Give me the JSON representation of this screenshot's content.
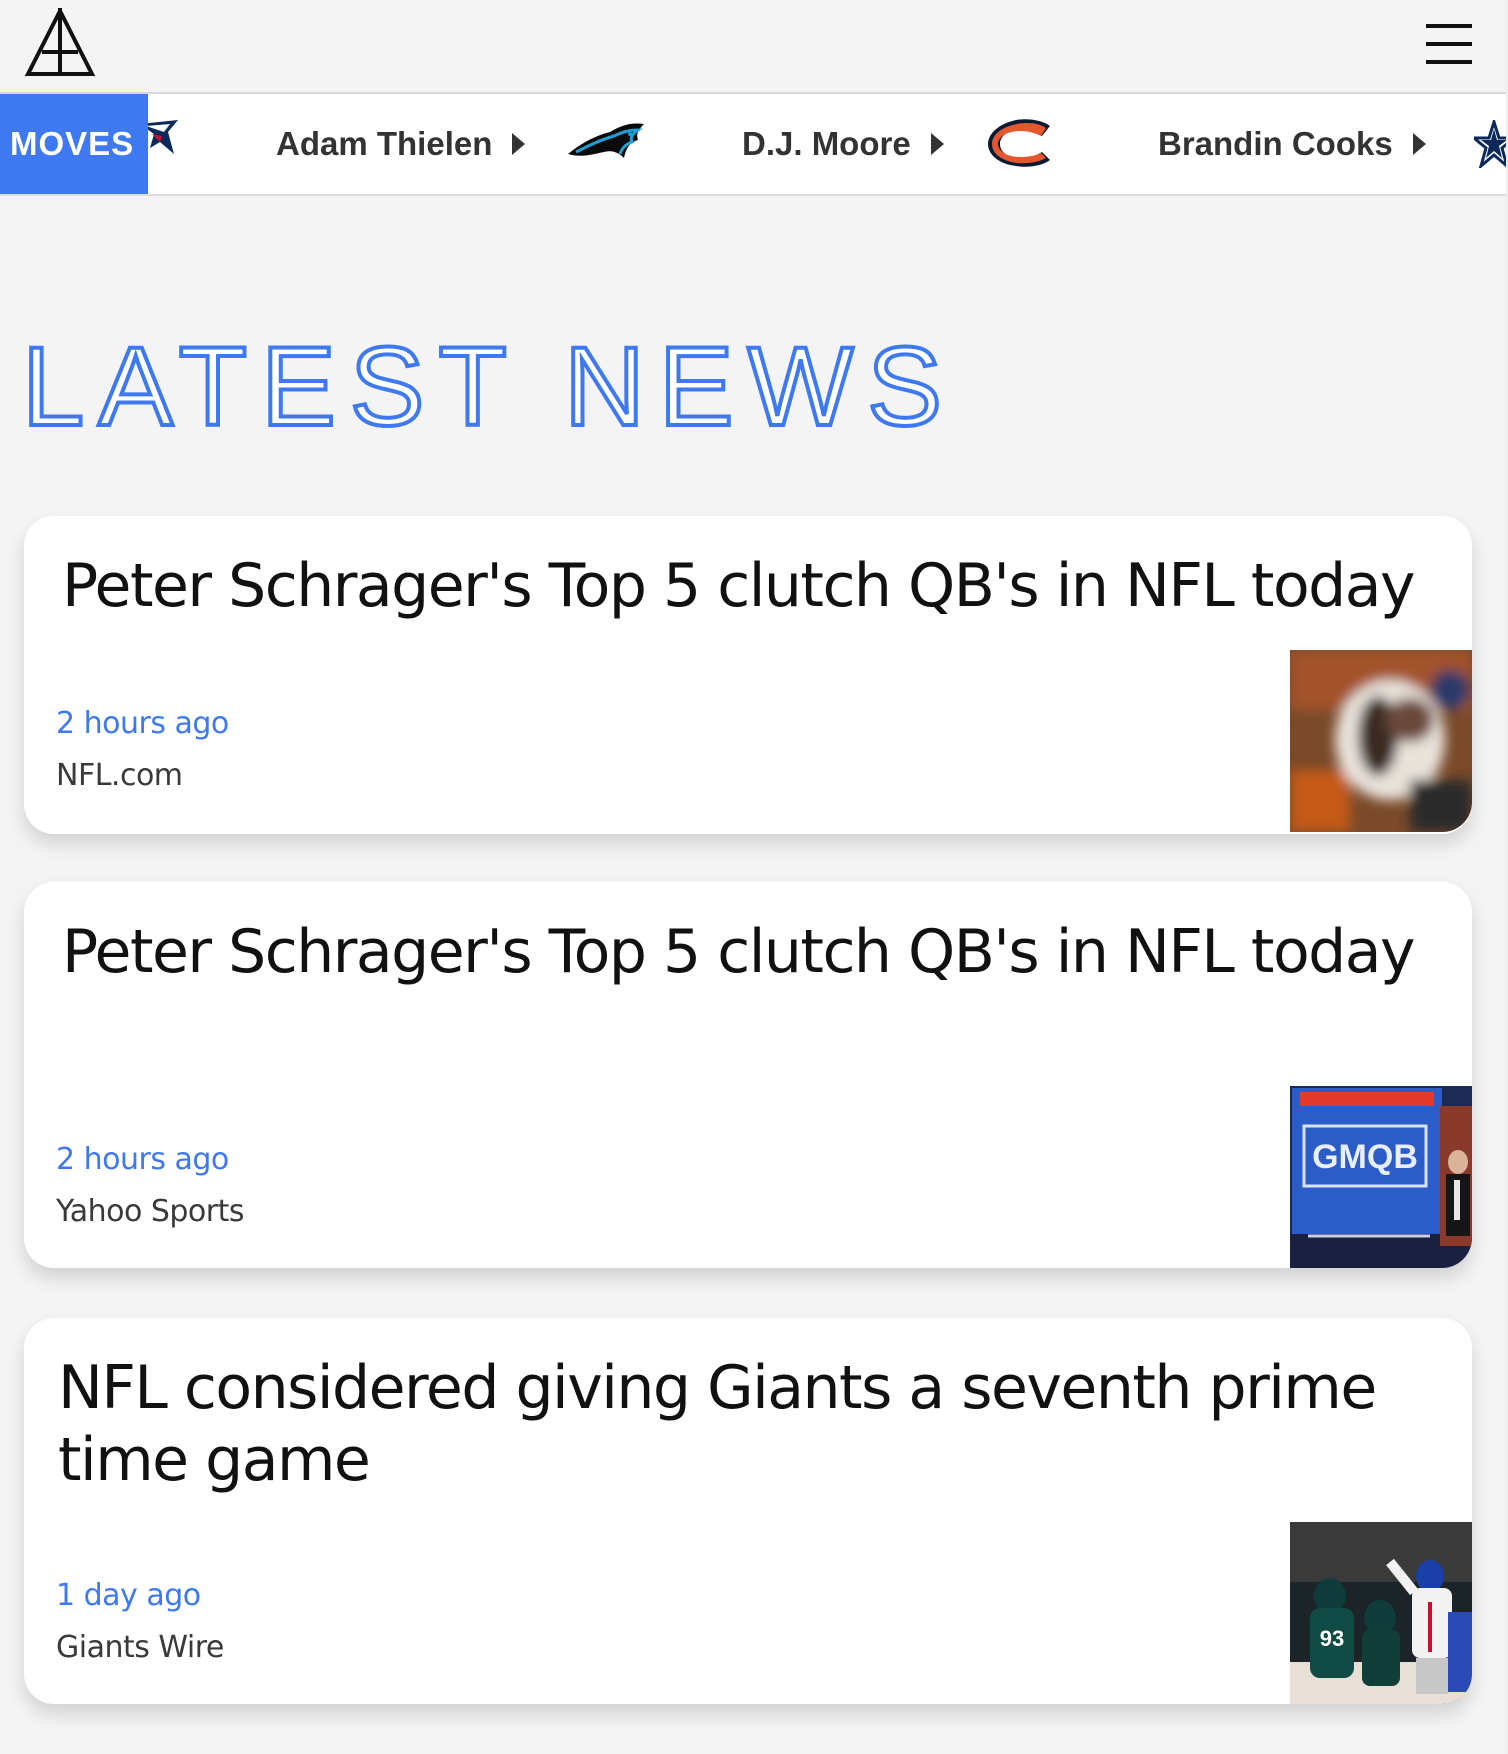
{
  "header": {
    "logo_icon": "a-frame-logo-icon",
    "menu_icon": "hamburger-menu-icon"
  },
  "ticker": {
    "badge_label": "MOVES",
    "moves": [
      {
        "player": "Adam Thielen",
        "to_team_icon": "panthers-logo-icon"
      },
      {
        "player": "D.J. Moore",
        "to_team_icon": "bears-logo-icon"
      },
      {
        "player": "Brandin Cooks",
        "to_team_icon": "cowboys-logo-icon"
      }
    ],
    "leading_team_icon": "patriots-logo-icon"
  },
  "section": {
    "title": "LATEST NEWS"
  },
  "news": [
    {
      "title": "Peter Schrager's Top 5 clutch QB's in NFL today",
      "time": "2 hours ago",
      "source": "NFL.com",
      "thumb_icon": "qb-action-thumbnail"
    },
    {
      "title": "Peter Schrager's Top 5 clutch QB's in NFL today",
      "time": "2 hours ago",
      "source": "Yahoo Sports",
      "thumb_icon": "gmqb-studio-thumbnail"
    },
    {
      "title": "NFL considered giving Giants a seventh prime time game",
      "time": "1 day ago",
      "source": "Giants Wire",
      "thumb_icon": "eagles-giants-game-thumbnail"
    }
  ],
  "colors": {
    "accent": "#3f79f2",
    "background": "#f4f4f4",
    "card": "#ffffff",
    "text": "#111111"
  }
}
